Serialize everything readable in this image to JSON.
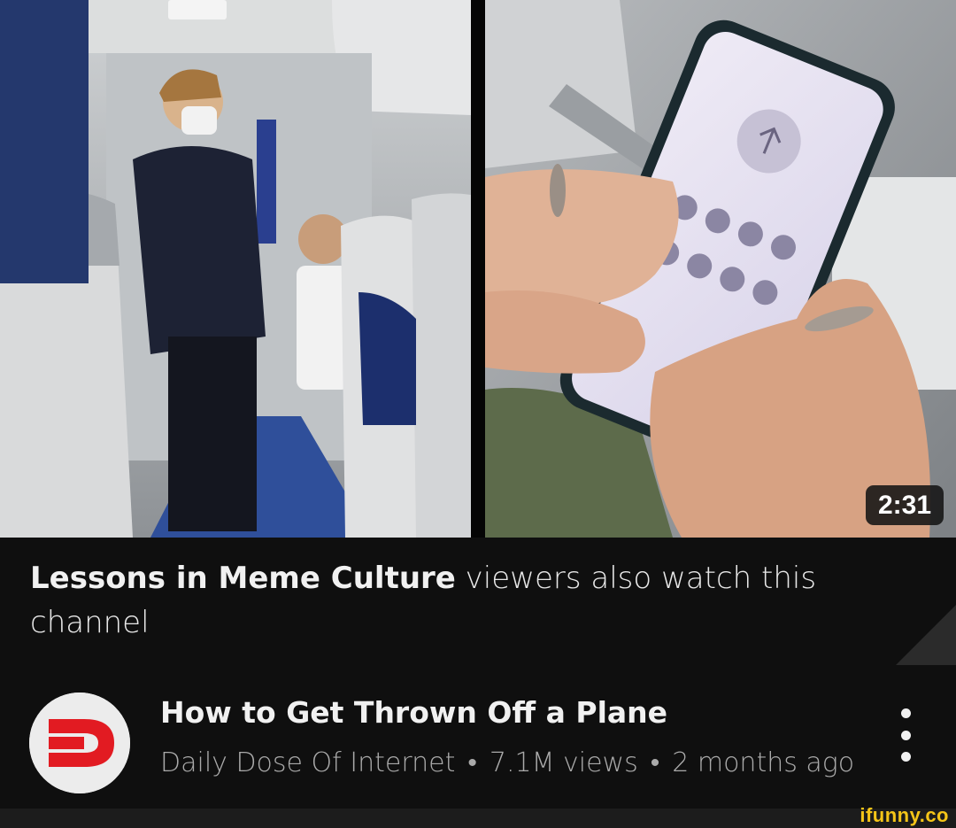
{
  "thumbnail": {
    "duration": "2:31"
  },
  "recommendation": {
    "channel_name": "Lessons in Meme Culture",
    "text": " viewers also watch this channel"
  },
  "video": {
    "title": "How to Get Thrown Off a Plane",
    "channel": "Daily Dose Of Internet",
    "separator": "•",
    "views": "7.1M views",
    "age": "2 months ago"
  },
  "icons": {
    "avatar": "daily-dose-of-internet-logo",
    "menu": "more-vert-icon"
  },
  "colors": {
    "background": "#0f0f0f",
    "logo_red": "#e21b22",
    "watermark": "#f5c518"
  },
  "watermark": {
    "text": "ifunny.co"
  }
}
